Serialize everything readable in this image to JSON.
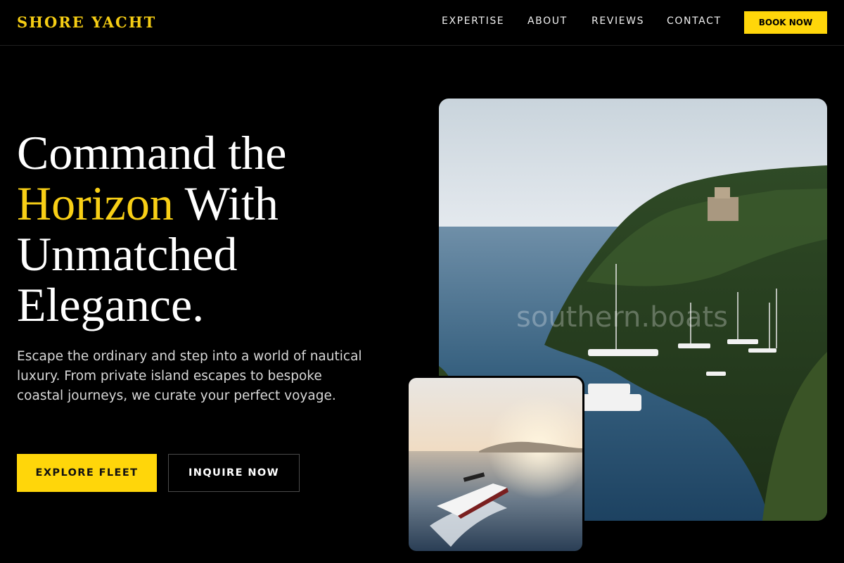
{
  "brand": {
    "name": "SHORE YACHT",
    "accent_color": "#ffd60a"
  },
  "nav": {
    "items": [
      "EXPERTISE",
      "ABOUT",
      "REVIEWS",
      "CONTACT"
    ],
    "cta": "BOOK NOW"
  },
  "hero": {
    "title_line1": "Command the",
    "title_accent": "Horizon",
    "title_after_accent": " With",
    "title_line3": "Unmatched",
    "title_line4": "Elegance.",
    "subtitle": "Escape the ordinary and step into a world of nautical luxury. From private island escapes to bespoke coastal journeys, we curate your perfect voyage.",
    "primary_button": "EXPLORE FLEET",
    "secondary_button": "INQUIRE NOW"
  },
  "images": {
    "main_watermark": "southern.boats"
  }
}
